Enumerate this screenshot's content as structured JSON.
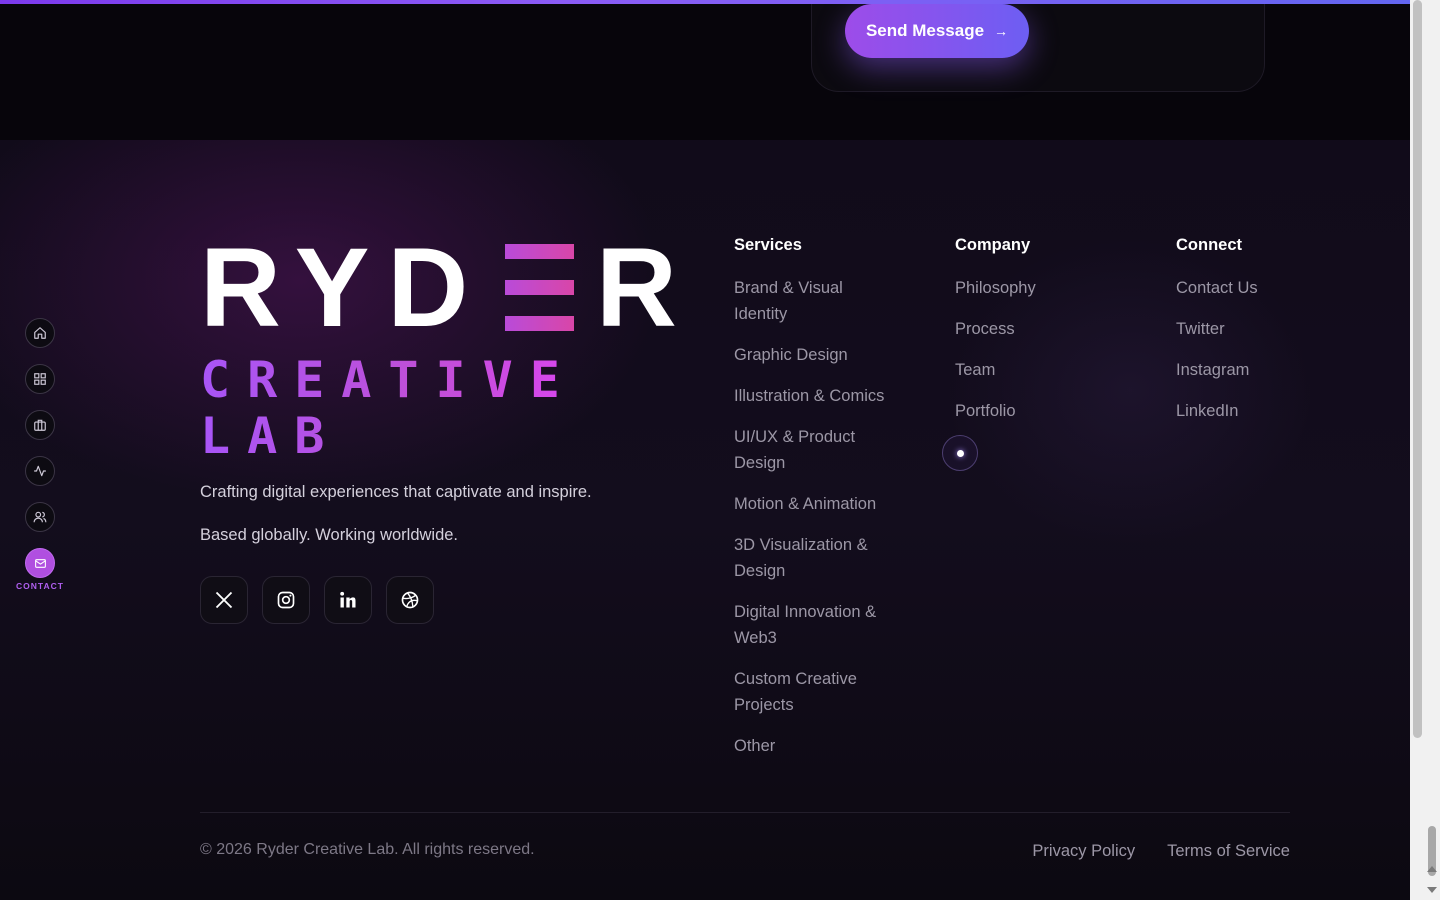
{
  "contact": {
    "send_label": "Send Message",
    "send_arrow": "→"
  },
  "brand": {
    "logo_left": "RYD",
    "logo_right": "R",
    "sub_line1": "CREATIVE",
    "sub_line2": "LAB",
    "tagline": "Crafting digital experiences that captivate and inspire.",
    "based": "Based globally. Working worldwide.",
    "socials": [
      "x-icon",
      "instagram-icon",
      "linkedin-icon",
      "dribbble-icon"
    ]
  },
  "footer": {
    "services": {
      "heading": "Services",
      "items": [
        "Brand & Visual Identity",
        "Graphic Design",
        "Illustration & Comics",
        "UI/UX & Product Design",
        "Motion & Animation",
        "3D Visualization & Design",
        "Digital Innovation & Web3",
        "Custom Creative Projects",
        "Other"
      ]
    },
    "company": {
      "heading": "Company",
      "items": [
        "Philosophy",
        "Process",
        "Team",
        "Portfolio"
      ]
    },
    "connect": {
      "heading": "Connect",
      "items": [
        "Contact Us",
        "Twitter",
        "Instagram",
        "LinkedIn"
      ]
    },
    "copyright": "© 2026 Ryder Creative Lab. All rights reserved.",
    "legal": {
      "privacy": "Privacy Policy",
      "terms": "Terms of Service"
    }
  },
  "sidenav": {
    "items": [
      "home-icon",
      "grid-icon",
      "briefcase-icon",
      "activity-icon",
      "users-icon",
      "mail-icon"
    ],
    "active_label": "CONTACT"
  },
  "colors": {
    "accent": "#a855f7",
    "accent_pink": "#d946ef",
    "background": "#110b1a"
  }
}
